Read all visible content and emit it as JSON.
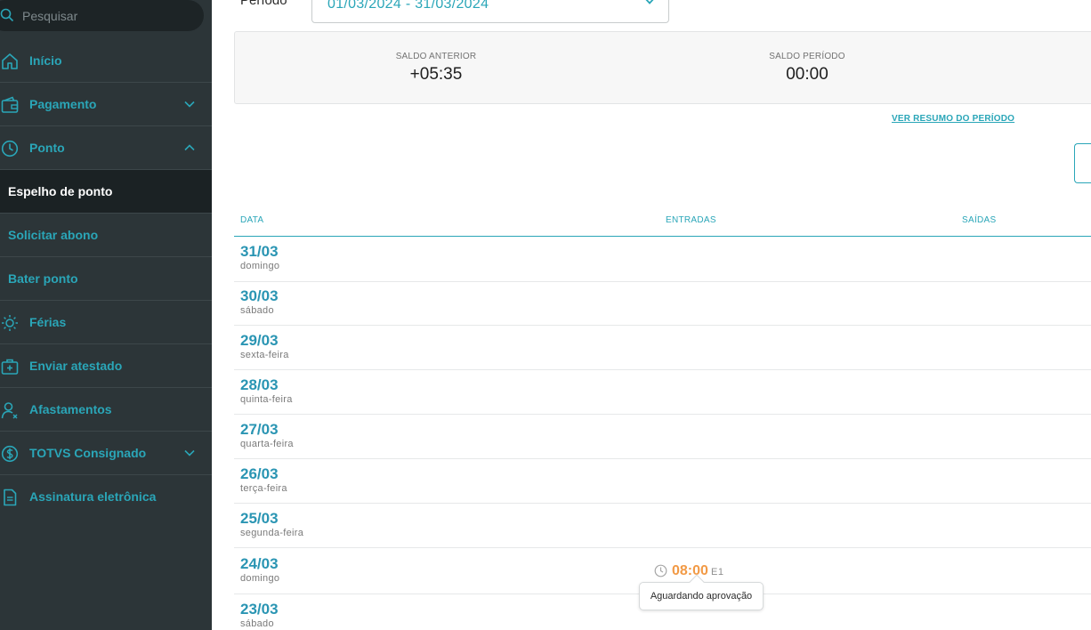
{
  "search": {
    "placeholder": "Pesquisar"
  },
  "sidebar": {
    "items": [
      {
        "label": "Início",
        "icon": "home-icon"
      },
      {
        "label": "Pagamento",
        "icon": "wallet-icon",
        "expanded": false
      },
      {
        "label": "Ponto",
        "icon": "clock-icon",
        "expanded": true
      },
      {
        "label": "Férias",
        "icon": "sun-icon"
      },
      {
        "label": "Enviar atestado",
        "icon": "medical-kit-icon"
      },
      {
        "label": "Afastamentos",
        "icon": "user-x-icon"
      },
      {
        "label": "TOTVS Consignado",
        "icon": "dollar-icon",
        "expanded": false
      },
      {
        "label": "Assinatura eletrônica",
        "icon": "document-icon"
      }
    ],
    "ponto_sub": [
      {
        "label": "Espelho de ponto",
        "active": true
      },
      {
        "label": "Solicitar abono",
        "active": false
      },
      {
        "label": "Bater ponto",
        "active": false
      }
    ]
  },
  "period": {
    "label": "Período",
    "value": "01/03/2024 - 31/03/2024"
  },
  "summary": {
    "saldo_anterior_label": "SALDO ANTERIOR",
    "saldo_anterior_value": "+05:35",
    "saldo_periodo_label": "SALDO PERÍODO",
    "saldo_periodo_value": "00:00",
    "link": "VER RESUMO DO PERÍODO"
  },
  "table": {
    "headers": {
      "date": "DATA",
      "entries": "ENTRADAS",
      "exits": "SAÍDAS"
    },
    "rows": [
      {
        "date": "31/03",
        "weekday": "domingo"
      },
      {
        "date": "30/03",
        "weekday": "sábado"
      },
      {
        "date": "29/03",
        "weekday": "sexta-feira"
      },
      {
        "date": "28/03",
        "weekday": "quinta-feira"
      },
      {
        "date": "27/03",
        "weekday": "quarta-feira"
      },
      {
        "date": "26/03",
        "weekday": "terça-feira"
      },
      {
        "date": "25/03",
        "weekday": "segunda-feira"
      },
      {
        "date": "24/03",
        "weekday": "domingo"
      },
      {
        "date": "23/03",
        "weekday": "sábado"
      }
    ],
    "punch": {
      "time": "08:00",
      "code": "E1",
      "tooltip": "Aguardando aprovação"
    }
  },
  "colors": {
    "accent": "#2aa6b8",
    "sidebar_bg": "#2c3538",
    "pending": "#f29a46"
  }
}
